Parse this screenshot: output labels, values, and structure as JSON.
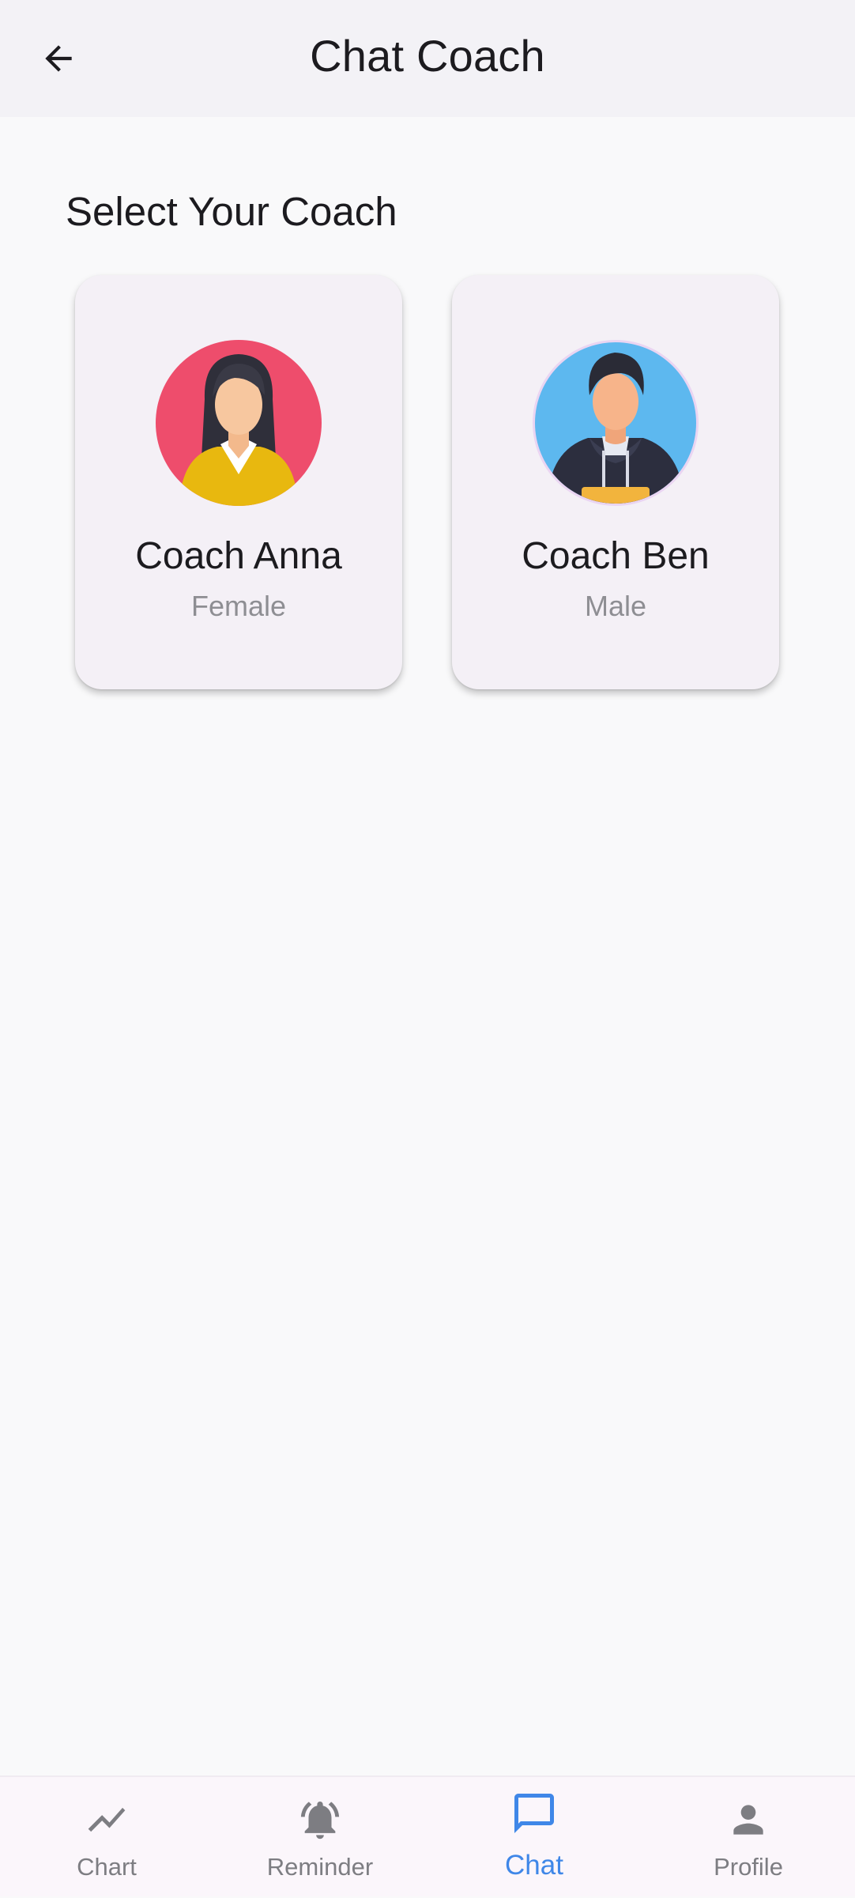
{
  "header": {
    "title": "Chat Coach",
    "back_icon": "arrow-left-icon"
  },
  "main": {
    "section_title": "Select Your Coach",
    "coaches": [
      {
        "name": "Coach Anna",
        "gender": "Female",
        "avatar_icon": "female-avatar",
        "avatar_bg": "#ee4d6c"
      },
      {
        "name": "Coach Ben",
        "gender": "Male",
        "avatar_icon": "male-avatar",
        "avatar_bg": "#5db8ef"
      }
    ]
  },
  "bottom_nav": {
    "active": "Chat",
    "active_color": "#3f87e8",
    "items": [
      {
        "label": "Chart",
        "icon": "trending-line-icon"
      },
      {
        "label": "Reminder",
        "icon": "bell-ringing-icon"
      },
      {
        "label": "Chat",
        "icon": "chat-bubble-icon"
      },
      {
        "label": "Profile",
        "icon": "person-icon"
      }
    ]
  }
}
